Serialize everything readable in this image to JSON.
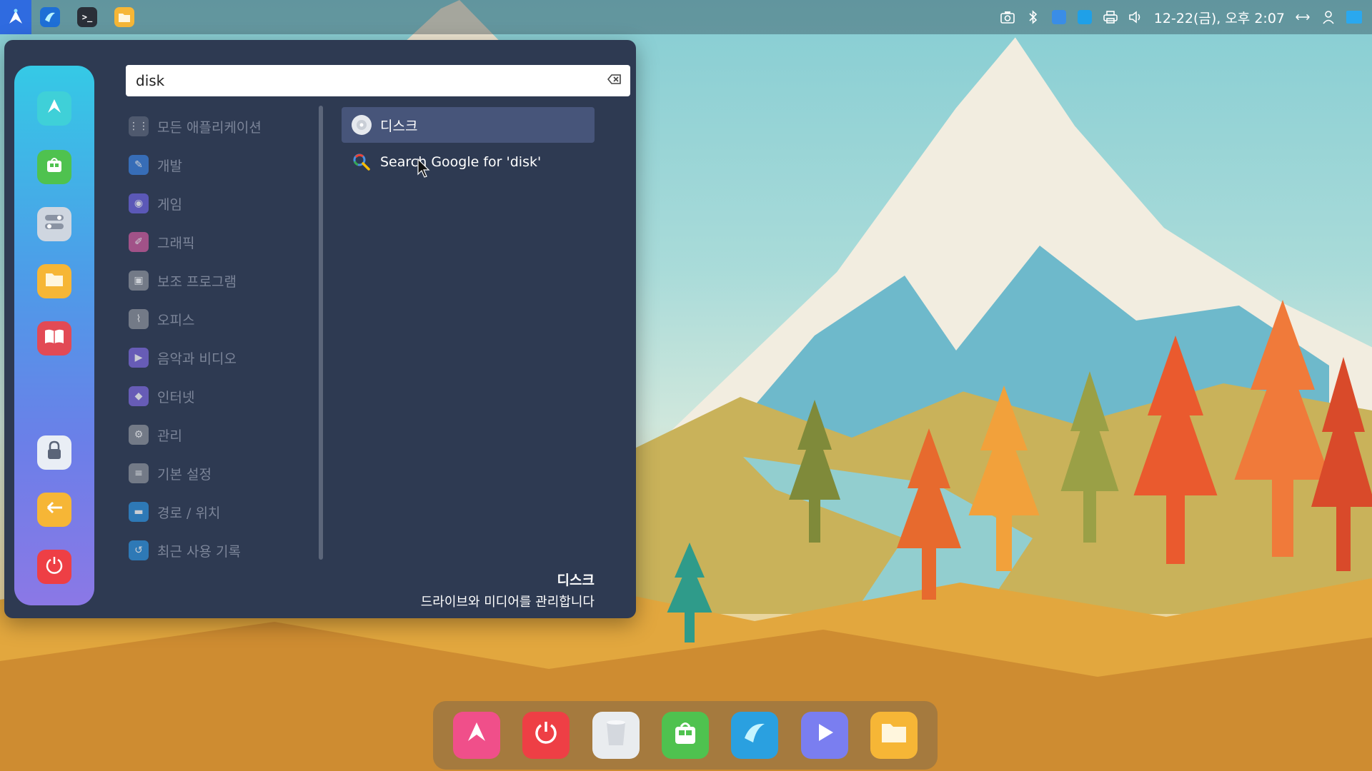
{
  "top_panel": {
    "apps": [
      {
        "name": "launcher-icon"
      },
      {
        "name": "browser-icon"
      },
      {
        "name": "terminal-icon",
        "glyph": ">_"
      },
      {
        "name": "files-icon"
      }
    ],
    "tray": [
      "screenshot-icon",
      "bluetooth-icon",
      "app-tray-icon",
      "remote-tray-icon",
      "printer-icon",
      "volume-icon"
    ],
    "clock": "12-22(금), 오후 2:07"
  },
  "menu": {
    "search": {
      "value": "disk",
      "placeholder": ""
    },
    "categories": [
      {
        "label": "모든 애플리케이션",
        "icon": "grid-icon",
        "color": "#5a6478"
      },
      {
        "label": "개발",
        "icon": "hammer-icon",
        "color": "#3b7fd9"
      },
      {
        "label": "게임",
        "icon": "gamepad-icon",
        "color": "#6a63d9"
      },
      {
        "label": "그래픽",
        "icon": "brush-icon",
        "color": "#c85b9a"
      },
      {
        "label": "보조 프로그램",
        "icon": "accessories-icon",
        "color": "#8a9099"
      },
      {
        "label": "오피스",
        "icon": "paperclip-icon",
        "color": "#8a9099"
      },
      {
        "label": "음악과 비디오",
        "icon": "play-icon",
        "color": "#7a68d8"
      },
      {
        "label": "인터넷",
        "icon": "internet-icon",
        "color": "#7a68d8"
      },
      {
        "label": "관리",
        "icon": "gear-icon",
        "color": "#8a9099"
      },
      {
        "label": "기본 설정",
        "icon": "settings-icon",
        "color": "#8a9099"
      },
      {
        "label": "경로 / 위치",
        "icon": "folder-icon",
        "color": "#2f8fd8"
      },
      {
        "label": "최근 사용 기록",
        "icon": "recent-folder-icon",
        "color": "#2f8fd8"
      }
    ],
    "results": [
      {
        "label": "디스크",
        "icon": "disk-icon",
        "selected": true
      },
      {
        "label": "Search Google for 'disk'",
        "icon": "search-icon",
        "selected": false
      }
    ],
    "description": {
      "title": "디스크",
      "text": "드라이브와 미디어를 관리합니다"
    },
    "favorites": [
      {
        "name": "software-manager-icon",
        "color": "#3fd0d8"
      },
      {
        "name": "app-store-icon",
        "color": "#4fc24f"
      },
      {
        "name": "settings-toggle-icon",
        "color": "#cfd6e0"
      },
      {
        "name": "files-icon",
        "color": "#f6b636"
      },
      {
        "name": "help-book-icon",
        "color": "#e24a55"
      },
      {
        "name": "lock-icon",
        "color": "#e9eef5"
      },
      {
        "name": "logout-icon",
        "color": "#f6b636"
      },
      {
        "name": "power-icon",
        "color": "#ee3f45"
      }
    ]
  },
  "dock": [
    {
      "name": "software-manager-icon",
      "color": "#f04f8a"
    },
    {
      "name": "power-icon",
      "color": "#ee3f45"
    },
    {
      "name": "trash-icon",
      "color": "#e9ecef"
    },
    {
      "name": "app-store-icon",
      "color": "#4fc24f"
    },
    {
      "name": "browser-icon",
      "color": "#2aa0e0"
    },
    {
      "name": "media-player-icon",
      "color": "#7a7ef0"
    },
    {
      "name": "files-icon",
      "color": "#f6b636"
    }
  ]
}
